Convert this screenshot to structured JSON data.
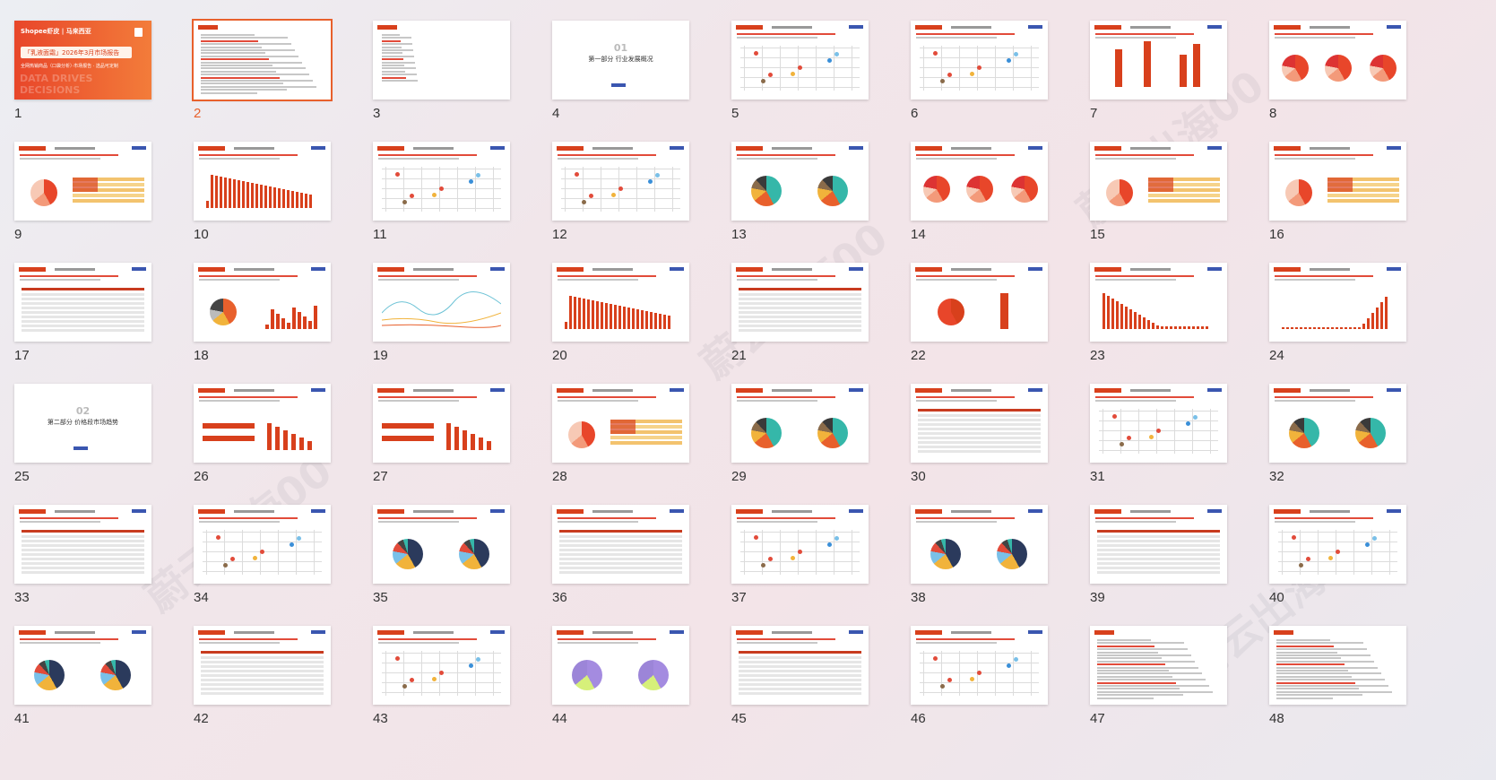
{
  "slides": [
    {
      "n": "1",
      "type": "cover"
    },
    {
      "n": "2",
      "type": "text",
      "selected": true
    },
    {
      "n": "3",
      "type": "toc"
    },
    {
      "n": "4",
      "type": "section"
    },
    {
      "n": "5",
      "type": "scatter"
    },
    {
      "n": "6",
      "type": "scatter"
    },
    {
      "n": "7",
      "type": "bars3"
    },
    {
      "n": "8",
      "type": "pie3"
    },
    {
      "n": "9",
      "type": "pie-table"
    },
    {
      "n": "10",
      "type": "bars"
    },
    {
      "n": "11",
      "type": "scatter"
    },
    {
      "n": "12",
      "type": "scatter"
    },
    {
      "n": "13",
      "type": "pie2teal"
    },
    {
      "n": "14",
      "type": "pie3"
    },
    {
      "n": "15",
      "type": "pie-table"
    },
    {
      "n": "16",
      "type": "pie-table"
    },
    {
      "n": "17",
      "type": "table"
    },
    {
      "n": "18",
      "type": "pie-bars"
    },
    {
      "n": "19",
      "type": "line"
    },
    {
      "n": "20",
      "type": "bars"
    },
    {
      "n": "21",
      "type": "table"
    },
    {
      "n": "22",
      "type": "pie-bar"
    },
    {
      "n": "23",
      "type": "bars-desc"
    },
    {
      "n": "24",
      "type": "bars-rise"
    },
    {
      "n": "25",
      "type": "section"
    },
    {
      "n": "26",
      "type": "hbars"
    },
    {
      "n": "27",
      "type": "hbars"
    },
    {
      "n": "28",
      "type": "pie-table"
    },
    {
      "n": "29",
      "type": "pie2teal"
    },
    {
      "n": "30",
      "type": "table"
    },
    {
      "n": "31",
      "type": "scatter"
    },
    {
      "n": "32",
      "type": "pie2teal"
    },
    {
      "n": "33",
      "type": "table"
    },
    {
      "n": "34",
      "type": "scatter"
    },
    {
      "n": "35",
      "type": "pie2dark"
    },
    {
      "n": "36",
      "type": "table"
    },
    {
      "n": "37",
      "type": "scatter"
    },
    {
      "n": "38",
      "type": "pie2dark"
    },
    {
      "n": "39",
      "type": "table"
    },
    {
      "n": "40",
      "type": "scatter"
    },
    {
      "n": "41",
      "type": "pie2dark"
    },
    {
      "n": "42",
      "type": "table"
    },
    {
      "n": "43",
      "type": "scatter"
    },
    {
      "n": "44",
      "type": "pie2purple"
    },
    {
      "n": "45",
      "type": "table"
    },
    {
      "n": "46",
      "type": "scatter"
    },
    {
      "n": "47",
      "type": "text"
    },
    {
      "n": "48",
      "type": "text"
    }
  ],
  "cover": {
    "brand": "Shopee虾皮 | 马来西亚",
    "headline": "「乳液面霜」2026年3月市场报告",
    "subtitle": "全网热销商品（口袋分析）·市场报告 · 选品可定制",
    "bg_text": "DATA DRIVES DECISIONS"
  },
  "sections": {
    "4": {
      "num": "01",
      "title": "第一部分  行业发展概况"
    },
    "25": {
      "num": "02",
      "title": "第二部分  价格段市场趋势"
    }
  },
  "watermark": "蔚云出海00",
  "colors": {
    "accent": "#e8602c",
    "brand_red": "#d8401c",
    "teal": "#35b7a9",
    "purple": "#a48be0"
  }
}
